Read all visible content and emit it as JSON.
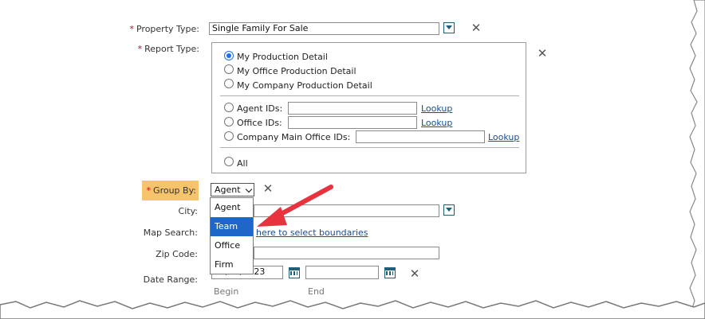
{
  "property_type": {
    "label": "Property Type:",
    "value": "Single Family For Sale"
  },
  "report_type": {
    "label": "Report Type:",
    "options": [
      {
        "label": "My Production Detail",
        "selected": true
      },
      {
        "label": "My Office Production Detail",
        "selected": false
      },
      {
        "label": "My Company Production Detail",
        "selected": false
      }
    ],
    "id_options": [
      {
        "label": "Agent IDs:",
        "value": "",
        "lookup": "Lookup"
      },
      {
        "label": "Office IDs:",
        "value": "",
        "lookup": "Lookup"
      },
      {
        "label": "Company Main Office IDs:",
        "value": "",
        "lookup": "Lookup"
      }
    ],
    "all_label": "All"
  },
  "group_by": {
    "label": "Group By:",
    "selected": "Agent",
    "options": [
      "Agent",
      "Team",
      "Office",
      "Firm"
    ],
    "highlighted": "Team"
  },
  "city": {
    "label": "City:",
    "value": ""
  },
  "map_search": {
    "label": "Map Search:",
    "link": "here to select boundaries"
  },
  "zip_code": {
    "label": "Zip Code:",
    "value": ""
  },
  "date_range": {
    "label": "Date Range:",
    "begin_value": "07/01/2023",
    "end_value": "",
    "begin_label": "Begin",
    "end_label": "End"
  },
  "colors": {
    "required": "#d0021b",
    "accent_blue": "#1e66c8",
    "arrow_red": "#e8333f",
    "group_by_highlight": "#f7c46c",
    "icon_teal": "#1f5f7a"
  }
}
